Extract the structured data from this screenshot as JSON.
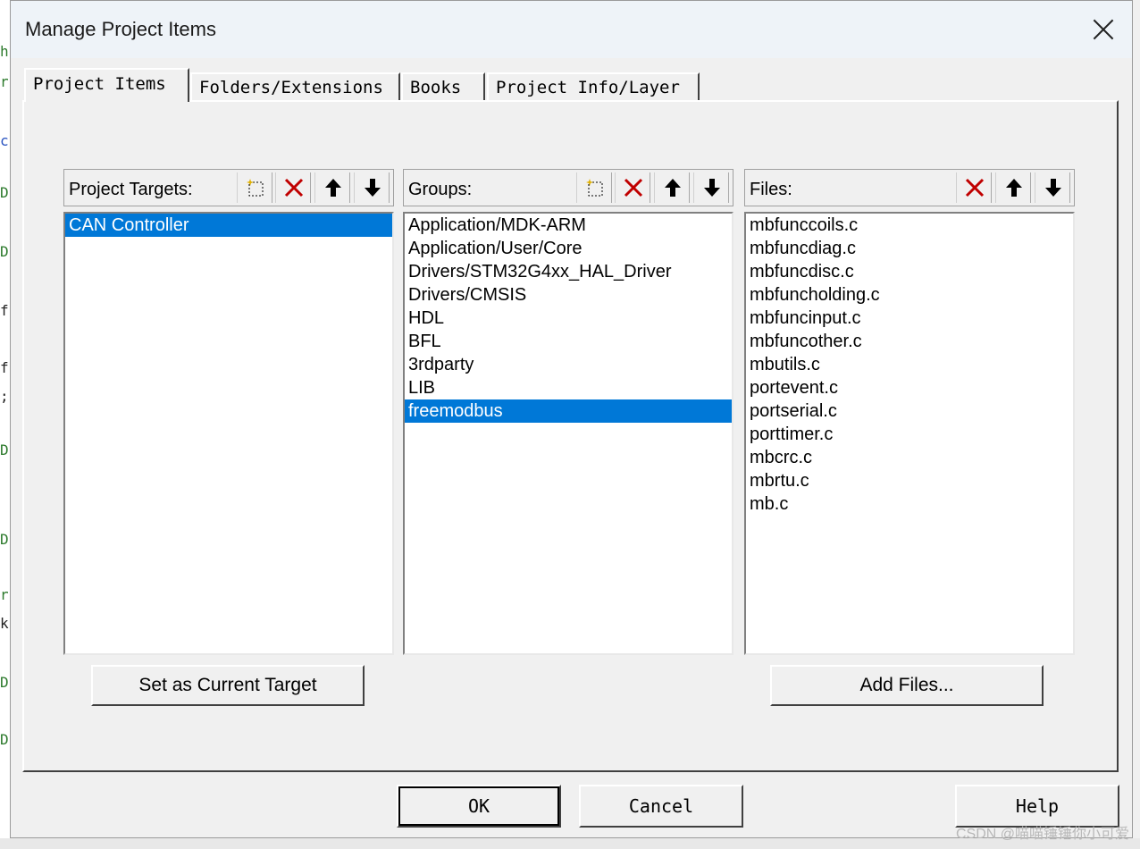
{
  "window": {
    "title": "Manage Project Items"
  },
  "tabs": [
    {
      "label": "Project Items",
      "active": true
    },
    {
      "label": "Folders/Extensions",
      "active": false
    },
    {
      "label": "Books",
      "active": false
    },
    {
      "label": "Project Info/Layer",
      "active": false
    }
  ],
  "targets": {
    "label": "Project Targets:",
    "items": [
      "CAN Controller"
    ],
    "selected_index": 0
  },
  "groups": {
    "label": "Groups:",
    "items": [
      "Application/MDK-ARM",
      "Application/User/Core",
      "Drivers/STM32G4xx_HAL_Driver",
      "Drivers/CMSIS",
      "HDL",
      "BFL",
      "3rdparty",
      "LIB",
      "freemodbus"
    ],
    "selected_index": 8
  },
  "files": {
    "label": "Files:",
    "items": [
      "mbfunccoils.c",
      "mbfuncdiag.c",
      "mbfuncdisc.c",
      "mbfuncholding.c",
      "mbfuncinput.c",
      "mbfuncother.c",
      "mbutils.c",
      "portevent.c",
      "portserial.c",
      "porttimer.c",
      "mbcrc.c",
      "mbrtu.c",
      "mb.c"
    ]
  },
  "buttons": {
    "set_target": "Set as Current Target",
    "add_files": "Add Files...",
    "ok": "OK",
    "cancel": "Cancel",
    "help": "Help"
  },
  "watermark": "CSDN @喵喵锤锤你小可爱",
  "colors": {
    "selection": "#0078d7",
    "delete_icon": "#c00000"
  }
}
